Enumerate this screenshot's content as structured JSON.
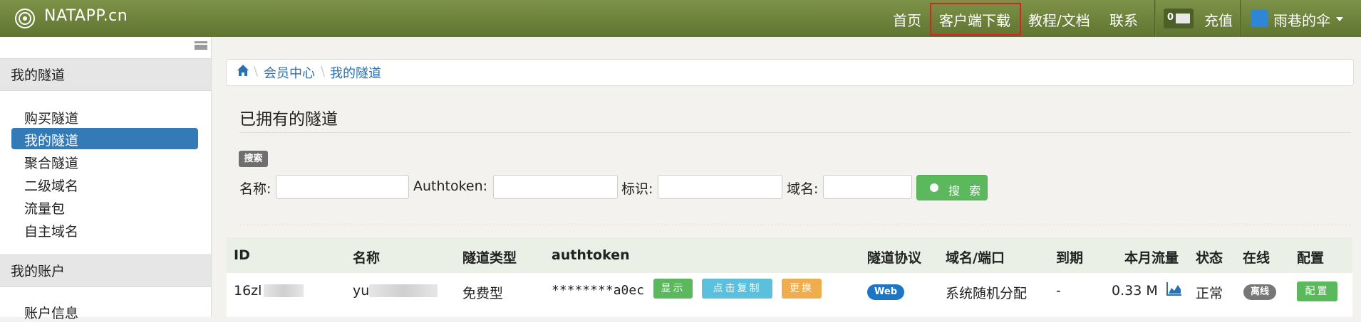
{
  "topbar": {
    "brand": "NATAPP.cn",
    "nav": [
      "首页",
      "客户端下载",
      "教程/文档",
      "联系"
    ],
    "mail_count": "0",
    "recharge": "充值",
    "username": "雨巷的伞",
    "highlight_color": "#e02020"
  },
  "sidebar": {
    "section1": "我的隧道",
    "items": [
      "购买隧道",
      "我的隧道",
      "聚合隧道",
      "二级域名",
      "流量包",
      "自主域名"
    ],
    "active_item": "我的隧道",
    "section2": "我的账户",
    "partial_item": "账户信息",
    "active_color": "#337ab7"
  },
  "breadcrumb": [
    "会员中心",
    "我的隧道"
  ],
  "page_title": "已拥有的隧道",
  "search": {
    "tag": "搜索",
    "labels": [
      "名称:",
      "Authtoken:",
      "标识:",
      "域名:"
    ],
    "button": "搜 索"
  },
  "table": {
    "headers": [
      "ID",
      "名称",
      "隧道类型",
      "authtoken",
      "隧道协议",
      "域名/端口",
      "到期",
      "本月流量",
      "状态",
      "在线",
      "配置"
    ],
    "row": {
      "id": "16zl",
      "name": "yu",
      "type": "免费型",
      "authtoken": "********a0ec",
      "btn_show": "显示",
      "btn_copy": "点击复制",
      "btn_change": "更换",
      "protocol": "Web",
      "domain": "系统随机分配",
      "expire": "-",
      "traffic": "0.33 M",
      "status": "正常",
      "online": "离线",
      "config": "配置"
    }
  }
}
